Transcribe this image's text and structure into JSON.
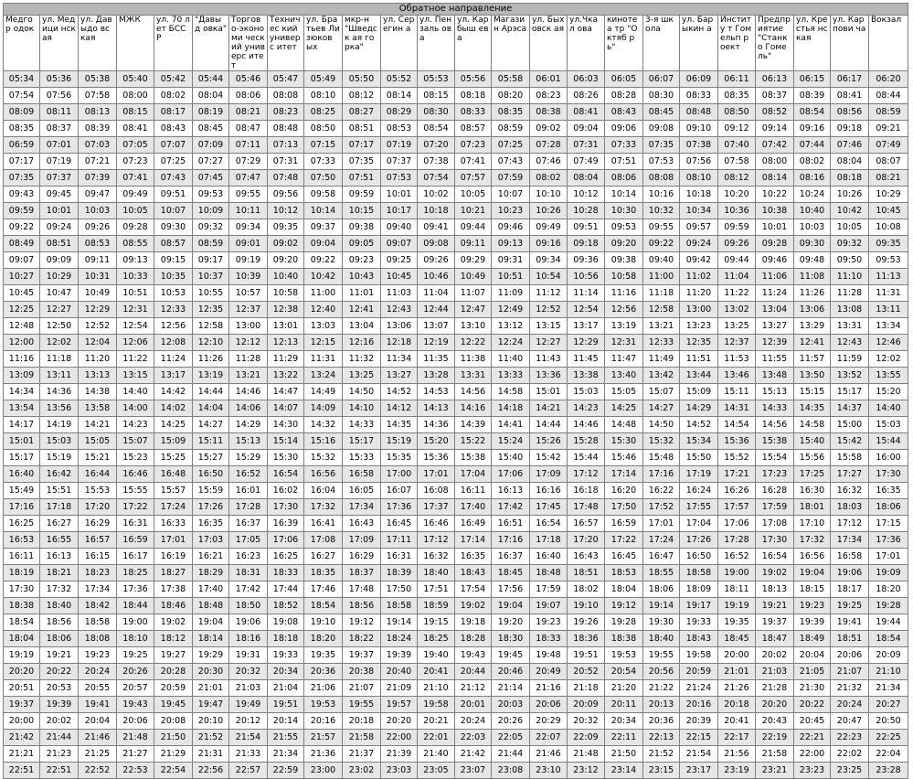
{
  "title": "Обратное направление",
  "stops": [
    "Медгор одок",
    "ул. Медици нская",
    "ул. Давыдо вская",
    "МЖК",
    "ул. 70 лет БССР",
    "\"Давыд овка\"",
    "Торгово-экономи ческий универс итет",
    "Техничес кий универс итет",
    "ул. Братьев Лизюков ых",
    "мкр-н \"Шведск ая горка\"",
    "ул. Серегин а",
    "ул. Пензаль ова",
    "ул. Карбыш ева",
    "Магазин Арэса",
    "ул. Быховск ая",
    "ул.Чкал ова",
    "кинотеа тр \"Октяб рь\"",
    "3-я школа",
    "ул. Барыкин а",
    "Институ т Гомельп роект",
    "Предпр иятие \"Станко Гомель\"",
    "ул. Крестья нская",
    "ул. Карпови ча",
    "Вокзал"
  ],
  "rows": [
    [
      "05:34",
      "05:36",
      "05:38",
      "05:40",
      "05:42",
      "05:44",
      "05:46",
      "05:47",
      "05:49",
      "05:50",
      "05:52",
      "05:53",
      "05:56",
      "05:58",
      "06:01",
      "06:03",
      "06:05",
      "06:07",
      "06:09",
      "06:11",
      "06:13",
      "06:15",
      "06:17",
      "06:20"
    ],
    [
      "07:54",
      "07:56",
      "07:58",
      "08:00",
      "08:02",
      "08:04",
      "08:06",
      "08:08",
      "08:10",
      "08:12",
      "08:14",
      "08:15",
      "08:18",
      "08:20",
      "08:23",
      "08:26",
      "08:28",
      "08:30",
      "08:33",
      "08:35",
      "08:37",
      "08:39",
      "08:41",
      "08:44"
    ],
    [
      "08:09",
      "08:11",
      "08:13",
      "08:15",
      "08:17",
      "08:19",
      "08:21",
      "08:23",
      "08:25",
      "08:27",
      "08:29",
      "08:30",
      "08:33",
      "08:35",
      "08:38",
      "08:41",
      "08:43",
      "08:45",
      "08:48",
      "08:50",
      "08:52",
      "08:54",
      "08:56",
      "08:59"
    ],
    [
      "08:35",
      "08:37",
      "08:39",
      "08:41",
      "08:43",
      "08:45",
      "08:47",
      "08:48",
      "08:50",
      "08:51",
      "08:53",
      "08:54",
      "08:57",
      "08:59",
      "09:02",
      "09:04",
      "09:06",
      "09:08",
      "09:10",
      "09:12",
      "09:14",
      "09:16",
      "09:18",
      "09:21"
    ],
    [
      "06:59",
      "07:01",
      "07:03",
      "07:05",
      "07:07",
      "07:09",
      "07:11",
      "07:13",
      "07:15",
      "07:17",
      "07:19",
      "07:20",
      "07:23",
      "07:25",
      "07:28",
      "07:31",
      "07:33",
      "07:35",
      "07:38",
      "07:40",
      "07:42",
      "07:44",
      "07:46",
      "07:49"
    ],
    [
      "07:17",
      "07:19",
      "07:21",
      "07:23",
      "07:25",
      "07:27",
      "07:29",
      "07:31",
      "07:33",
      "07:35",
      "07:37",
      "07:38",
      "07:41",
      "07:43",
      "07:46",
      "07:49",
      "07:51",
      "07:53",
      "07:56",
      "07:58",
      "08:00",
      "08:02",
      "08:04",
      "08:07"
    ],
    [
      "07:35",
      "07:37",
      "07:39",
      "07:41",
      "07:43",
      "07:45",
      "07:47",
      "07:48",
      "07:50",
      "07:51",
      "07:53",
      "07:54",
      "07:57",
      "07:59",
      "08:02",
      "08:04",
      "08:06",
      "08:08",
      "08:10",
      "08:12",
      "08:14",
      "08:16",
      "08:18",
      "08:21"
    ],
    [
      "09:43",
      "09:45",
      "09:47",
      "09:49",
      "09:51",
      "09:53",
      "09:55",
      "09:56",
      "09:58",
      "09:59",
      "10:01",
      "10:02",
      "10:05",
      "10:07",
      "10:10",
      "10:12",
      "10:14",
      "10:16",
      "10:18",
      "10:20",
      "10:22",
      "10:24",
      "10:26",
      "10:29"
    ],
    [
      "09:59",
      "10:01",
      "10:03",
      "10:05",
      "10:07",
      "10:09",
      "10:11",
      "10:12",
      "10:14",
      "10:15",
      "10:17",
      "10:18",
      "10:21",
      "10:23",
      "10:26",
      "10:28",
      "10:30",
      "10:32",
      "10:34",
      "10:36",
      "10:38",
      "10:40",
      "10:42",
      "10:45"
    ],
    [
      "09:22",
      "09:24",
      "09:26",
      "09:28",
      "09:30",
      "09:32",
      "09:34",
      "09:35",
      "09:37",
      "09:38",
      "09:40",
      "09:41",
      "09:44",
      "09:46",
      "09:49",
      "09:51",
      "09:53",
      "09:55",
      "09:57",
      "09:59",
      "10:01",
      "10:03",
      "10:05",
      "10:08"
    ],
    [
      "08:49",
      "08:51",
      "08:53",
      "08:55",
      "08:57",
      "08:59",
      "09:01",
      "09:02",
      "09:04",
      "09:05",
      "09:07",
      "09:08",
      "09:11",
      "09:13",
      "09:16",
      "09:18",
      "09:20",
      "09:22",
      "09:24",
      "09:26",
      "09:28",
      "09:30",
      "09:32",
      "09:35"
    ],
    [
      "09:07",
      "09:09",
      "09:11",
      "09:13",
      "09:15",
      "09:17",
      "09:19",
      "09:20",
      "09:22",
      "09:23",
      "09:25",
      "09:26",
      "09:29",
      "09:31",
      "09:34",
      "09:36",
      "09:38",
      "09:40",
      "09:42",
      "09:44",
      "09:46",
      "09:48",
      "09:50",
      "09:53"
    ],
    [
      "10:27",
      "10:29",
      "10:31",
      "10:33",
      "10:35",
      "10:37",
      "10:39",
      "10:40",
      "10:42",
      "10:43",
      "10:45",
      "10:46",
      "10:49",
      "10:51",
      "10:54",
      "10:56",
      "10:58",
      "11:00",
      "11:02",
      "11:04",
      "11:06",
      "11:08",
      "11:10",
      "11:13"
    ],
    [
      "10:45",
      "10:47",
      "10:49",
      "10:51",
      "10:53",
      "10:55",
      "10:57",
      "10:58",
      "11:00",
      "11:01",
      "11:03",
      "11:04",
      "11:07",
      "11:09",
      "11:12",
      "11:14",
      "11:16",
      "11:18",
      "11:20",
      "11:22",
      "11:24",
      "11:26",
      "11:28",
      "11:31"
    ],
    [
      "12:25",
      "12:27",
      "12:29",
      "12:31",
      "12:33",
      "12:35",
      "12:37",
      "12:38",
      "12:40",
      "12:41",
      "12:43",
      "12:44",
      "12:47",
      "12:49",
      "12:52",
      "12:54",
      "12:56",
      "12:58",
      "13:00",
      "13:02",
      "13:04",
      "13:06",
      "13:08",
      "13:11"
    ],
    [
      "12:48",
      "12:50",
      "12:52",
      "12:54",
      "12:56",
      "12:58",
      "13:00",
      "13:01",
      "13:03",
      "13:04",
      "13:06",
      "13:07",
      "13:10",
      "13:12",
      "13:15",
      "13:17",
      "13:19",
      "13:21",
      "13:23",
      "13:25",
      "13:27",
      "13:29",
      "13:31",
      "13:34"
    ],
    [
      "12:00",
      "12:02",
      "12:04",
      "12:06",
      "12:08",
      "12:10",
      "12:12",
      "12:13",
      "12:15",
      "12:16",
      "12:18",
      "12:19",
      "12:22",
      "12:24",
      "12:27",
      "12:29",
      "12:31",
      "12:33",
      "12:35",
      "12:37",
      "12:39",
      "12:41",
      "12:43",
      "12:46"
    ],
    [
      "11:16",
      "11:18",
      "11:20",
      "11:22",
      "11:24",
      "11:26",
      "11:28",
      "11:29",
      "11:31",
      "11:32",
      "11:34",
      "11:35",
      "11:38",
      "11:40",
      "11:43",
      "11:45",
      "11:47",
      "11:49",
      "11:51",
      "11:53",
      "11:55",
      "11:57",
      "11:59",
      "12:02"
    ],
    [
      "13:09",
      "13:11",
      "13:13",
      "13:15",
      "13:17",
      "13:19",
      "13:21",
      "13:22",
      "13:24",
      "13:25",
      "13:27",
      "13:28",
      "13:31",
      "13:33",
      "13:36",
      "13:38",
      "13:40",
      "13:42",
      "13:44",
      "13:46",
      "13:48",
      "13:50",
      "13:52",
      "13:55"
    ],
    [
      "14:34",
      "14:36",
      "14:38",
      "14:40",
      "14:42",
      "14:44",
      "14:46",
      "14:47",
      "14:49",
      "14:50",
      "14:52",
      "14:53",
      "14:56",
      "14:58",
      "15:01",
      "15:03",
      "15:05",
      "15:07",
      "15:09",
      "15:11",
      "15:13",
      "15:15",
      "15:17",
      "15:20"
    ],
    [
      "13:54",
      "13:56",
      "13:58",
      "14:00",
      "14:02",
      "14:04",
      "14:06",
      "14:07",
      "14:09",
      "14:10",
      "14:12",
      "14:13",
      "14:16",
      "14:18",
      "14:21",
      "14:23",
      "14:25",
      "14:27",
      "14:29",
      "14:31",
      "14:33",
      "14:35",
      "14:37",
      "14:40"
    ],
    [
      "14:17",
      "14:19",
      "14:21",
      "14:23",
      "14:25",
      "14:27",
      "14:29",
      "14:30",
      "14:32",
      "14:33",
      "14:35",
      "14:36",
      "14:39",
      "14:41",
      "14:44",
      "14:46",
      "14:48",
      "14:50",
      "14:52",
      "14:54",
      "14:56",
      "14:58",
      "15:00",
      "15:03"
    ],
    [
      "15:01",
      "15:03",
      "15:05",
      "15:07",
      "15:09",
      "15:11",
      "15:13",
      "15:14",
      "15:16",
      "15:17",
      "15:19",
      "15:20",
      "15:22",
      "15:24",
      "15:26",
      "15:28",
      "15:30",
      "15:32",
      "15:34",
      "15:36",
      "15:38",
      "15:40",
      "15:42",
      "15:44"
    ],
    [
      "15:17",
      "15:19",
      "15:21",
      "15:23",
      "15:25",
      "15:27",
      "15:29",
      "15:30",
      "15:32",
      "15:33",
      "15:35",
      "15:36",
      "15:38",
      "15:40",
      "15:42",
      "15:44",
      "15:46",
      "15:48",
      "15:50",
      "15:52",
      "15:54",
      "15:56",
      "15:58",
      "16:00"
    ],
    [
      "16:40",
      "16:42",
      "16:44",
      "16:46",
      "16:48",
      "16:50",
      "16:52",
      "16:54",
      "16:56",
      "16:58",
      "17:00",
      "17:01",
      "17:04",
      "17:06",
      "17:09",
      "17:12",
      "17:14",
      "17:16",
      "17:19",
      "17:21",
      "17:23",
      "17:25",
      "17:27",
      "17:30"
    ],
    [
      "15:49",
      "15:51",
      "15:53",
      "15:55",
      "15:57",
      "15:59",
      "16:01",
      "16:02",
      "16:04",
      "16:05",
      "16:07",
      "16:08",
      "16:11",
      "16:13",
      "16:16",
      "16:18",
      "16:20",
      "16:22",
      "16:24",
      "16:26",
      "16:28",
      "16:30",
      "16:32",
      "16:35"
    ],
    [
      "17:16",
      "17:18",
      "17:20",
      "17:22",
      "17:24",
      "17:26",
      "17:28",
      "17:30",
      "17:32",
      "17:34",
      "17:36",
      "17:37",
      "17:40",
      "17:42",
      "17:45",
      "17:48",
      "17:50",
      "17:52",
      "17:55",
      "17:57",
      "17:59",
      "18:01",
      "18:03",
      "18:06"
    ],
    [
      "16:25",
      "16:27",
      "16:29",
      "16:31",
      "16:33",
      "16:35",
      "16:37",
      "16:39",
      "16:41",
      "16:43",
      "16:45",
      "16:46",
      "16:49",
      "16:51",
      "16:54",
      "16:57",
      "16:59",
      "17:01",
      "17:04",
      "17:06",
      "17:08",
      "17:10",
      "17:12",
      "17:15"
    ],
    [
      "16:53",
      "16:55",
      "16:57",
      "16:59",
      "17:01",
      "17:03",
      "17:05",
      "17:06",
      "17:08",
      "17:09",
      "17:11",
      "17:12",
      "17:14",
      "17:16",
      "17:18",
      "17:20",
      "17:22",
      "17:24",
      "17:26",
      "17:28",
      "17:30",
      "17:32",
      "17:34",
      "17:36"
    ],
    [
      "16:11",
      "16:13",
      "16:15",
      "16:17",
      "16:19",
      "16:21",
      "16:23",
      "16:25",
      "16:27",
      "16:29",
      "16:31",
      "16:32",
      "16:35",
      "16:37",
      "16:40",
      "16:43",
      "16:45",
      "16:47",
      "16:50",
      "16:52",
      "16:54",
      "16:56",
      "16:58",
      "17:01"
    ],
    [
      "18:19",
      "18:21",
      "18:23",
      "18:25",
      "18:27",
      "18:29",
      "18:31",
      "18:33",
      "18:35",
      "18:37",
      "18:39",
      "18:40",
      "18:43",
      "18:45",
      "18:48",
      "18:51",
      "18:53",
      "18:55",
      "18:58",
      "19:00",
      "19:02",
      "19:04",
      "19:06",
      "19:09"
    ],
    [
      "17:30",
      "17:32",
      "17:34",
      "17:36",
      "17:38",
      "17:40",
      "17:42",
      "17:44",
      "17:46",
      "17:48",
      "17:50",
      "17:51",
      "17:54",
      "17:56",
      "17:59",
      "18:02",
      "18:04",
      "18:06",
      "18:09",
      "18:11",
      "18:13",
      "18:15",
      "18:17",
      "18:20"
    ],
    [
      "18:38",
      "18:40",
      "18:42",
      "18:44",
      "18:46",
      "18:48",
      "18:50",
      "18:52",
      "18:54",
      "18:56",
      "18:58",
      "18:59",
      "19:02",
      "19:04",
      "19:07",
      "19:10",
      "19:12",
      "19:14",
      "19:17",
      "19:19",
      "19:21",
      "19:23",
      "19:25",
      "19:28"
    ],
    [
      "18:54",
      "18:56",
      "18:58",
      "19:00",
      "19:02",
      "19:04",
      "19:06",
      "19:08",
      "19:10",
      "19:12",
      "19:14",
      "19:15",
      "19:18",
      "19:20",
      "19:23",
      "19:26",
      "19:28",
      "19:30",
      "19:33",
      "19:35",
      "19:37",
      "19:39",
      "19:41",
      "19:44"
    ],
    [
      "18:04",
      "18:06",
      "18:08",
      "18:10",
      "18:12",
      "18:14",
      "18:16",
      "18:18",
      "18:20",
      "18:22",
      "18:24",
      "18:25",
      "18:28",
      "18:30",
      "18:33",
      "18:36",
      "18:38",
      "18:40",
      "18:43",
      "18:45",
      "18:47",
      "18:49",
      "18:51",
      "18:54"
    ],
    [
      "19:19",
      "19:21",
      "19:23",
      "19:25",
      "19:27",
      "19:29",
      "19:31",
      "19:33",
      "19:35",
      "19:37",
      "19:39",
      "19:40",
      "19:43",
      "19:45",
      "19:48",
      "19:51",
      "19:53",
      "19:55",
      "19:58",
      "20:00",
      "20:02",
      "20:04",
      "20:06",
      "20:09"
    ],
    [
      "20:20",
      "20:22",
      "20:24",
      "20:26",
      "20:28",
      "20:30",
      "20:32",
      "20:34",
      "20:36",
      "20:38",
      "20:40",
      "20:41",
      "20:44",
      "20:46",
      "20:49",
      "20:52",
      "20:54",
      "20:56",
      "20:59",
      "21:01",
      "21:03",
      "21:05",
      "21:07",
      "21:10"
    ],
    [
      "20:51",
      "20:53",
      "20:55",
      "20:57",
      "20:59",
      "21:01",
      "21:03",
      "21:04",
      "21:06",
      "21:07",
      "21:09",
      "21:10",
      "21:12",
      "21:14",
      "21:16",
      "21:18",
      "21:20",
      "21:22",
      "21:24",
      "21:26",
      "21:28",
      "21:30",
      "21:32",
      "21:34"
    ],
    [
      "19:37",
      "19:39",
      "19:41",
      "19:43",
      "19:45",
      "19:47",
      "19:49",
      "19:51",
      "19:53",
      "19:55",
      "19:57",
      "19:58",
      "20:01",
      "20:03",
      "20:06",
      "20:09",
      "20:11",
      "20:13",
      "20:16",
      "20:18",
      "20:20",
      "20:22",
      "20:24",
      "20:27"
    ],
    [
      "20:00",
      "20:02",
      "20:04",
      "20:06",
      "20:08",
      "20:10",
      "20:12",
      "20:14",
      "20:16",
      "20:18",
      "20:20",
      "20:21",
      "20:24",
      "20:26",
      "20:29",
      "20:32",
      "20:34",
      "20:36",
      "20:39",
      "20:41",
      "20:43",
      "20:45",
      "20:47",
      "20:50"
    ],
    [
      "21:42",
      "21:44",
      "21:46",
      "21:48",
      "21:50",
      "21:52",
      "21:54",
      "21:55",
      "21:57",
      "21:58",
      "22:00",
      "22:01",
      "22:03",
      "22:05",
      "22:07",
      "22:09",
      "22:11",
      "22:13",
      "22:15",
      "22:17",
      "22:19",
      "22:21",
      "22:23",
      "22:25"
    ],
    [
      "21:21",
      "21:23",
      "21:25",
      "21:27",
      "21:29",
      "21:31",
      "21:33",
      "21:34",
      "21:36",
      "21:37",
      "21:39",
      "21:40",
      "21:42",
      "21:44",
      "21:46",
      "21:48",
      "21:50",
      "21:52",
      "21:54",
      "21:56",
      "21:58",
      "22:00",
      "22:02",
      "22:04"
    ],
    [
      "22:51",
      "22:51",
      "22:52",
      "22:53",
      "22:54",
      "22:56",
      "22:57",
      "22:59",
      "23:00",
      "23:02",
      "23:03",
      "23:05",
      "23:07",
      "23:08",
      "23:10",
      "23:12",
      "23:14",
      "23:15",
      "23:17",
      "23:19",
      "23:21",
      "23:23",
      "23:25",
      "23:28"
    ]
  ]
}
